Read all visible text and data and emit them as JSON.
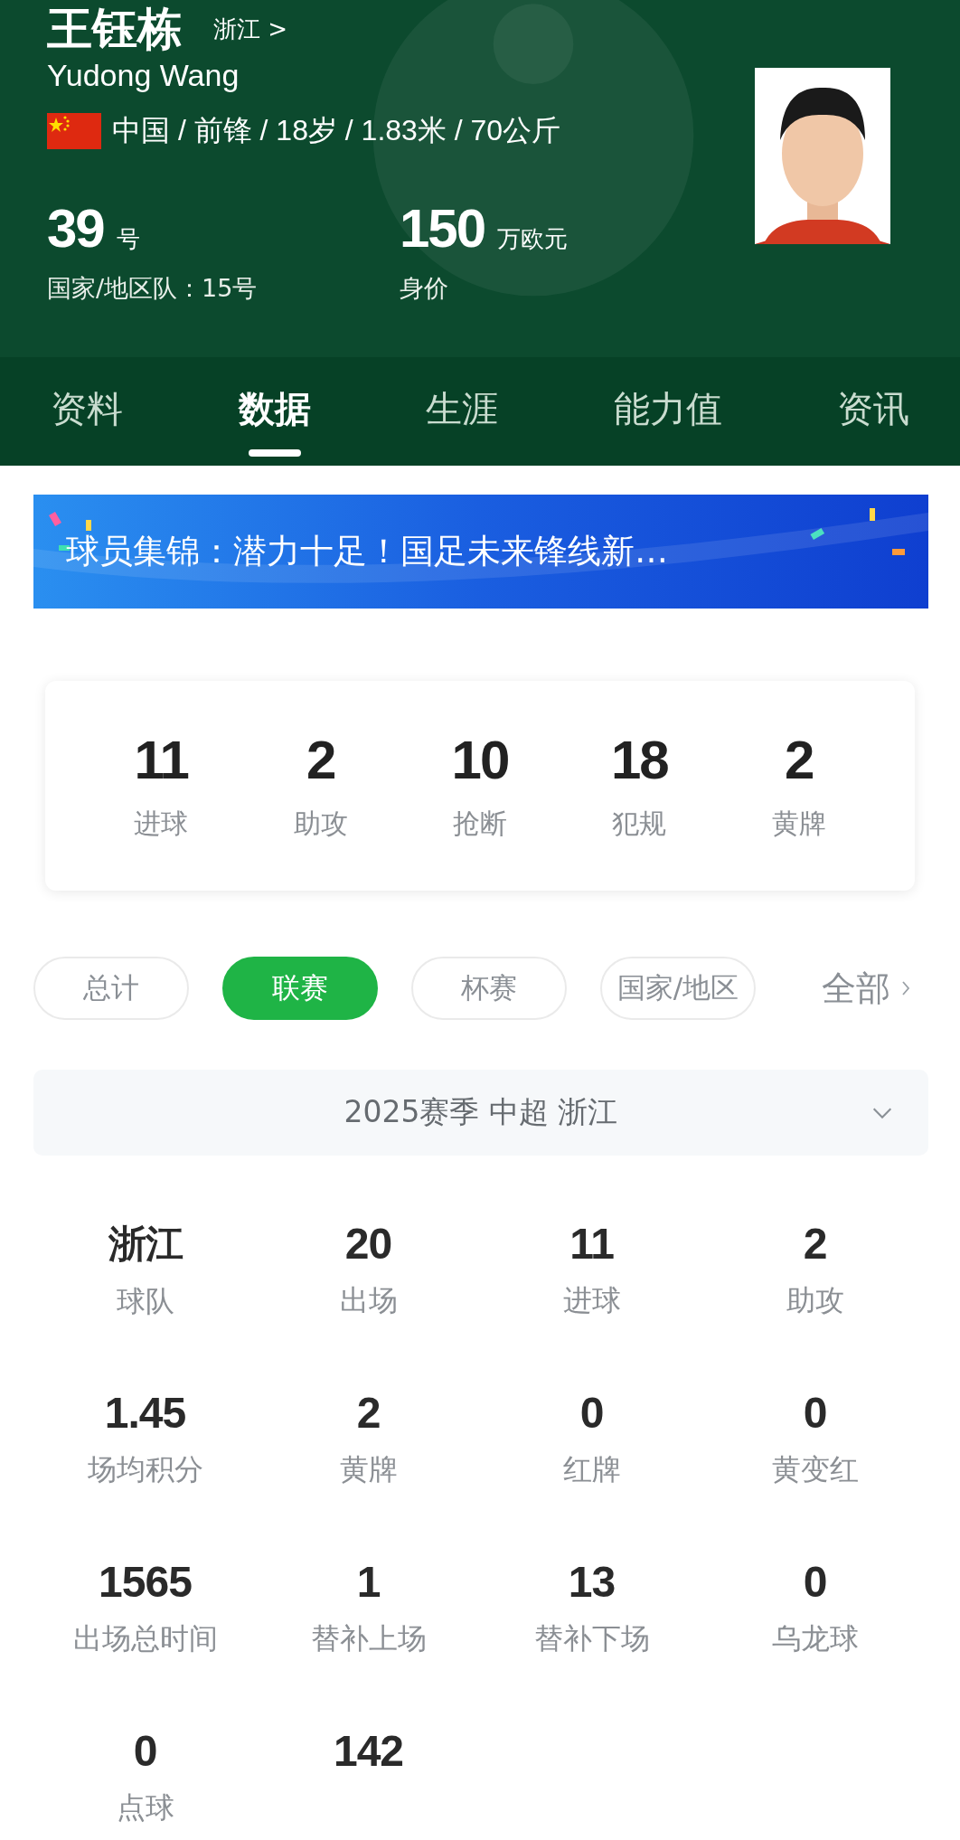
{
  "player": {
    "name": "王钰栋",
    "team_link": "浙江 >",
    "name_en": "Yudong Wang",
    "info": "中国 / 前锋 / 18岁 / 1.83米 / 70公斤",
    "number": "39",
    "number_unit": "号",
    "national_number": "国家/地区队：15号",
    "value": "150",
    "value_unit": "万欧元",
    "value_label": "身价"
  },
  "tabs": [
    {
      "label": "资料",
      "selected": false
    },
    {
      "label": "数据",
      "selected": true
    },
    {
      "label": "生涯",
      "selected": false
    },
    {
      "label": "能力值",
      "selected": false
    },
    {
      "label": "资讯",
      "selected": false
    }
  ],
  "banner": {
    "text": "球员集锦：潜力十足！国足未来锋线新…"
  },
  "summary": [
    {
      "value": "11",
      "label": "进球"
    },
    {
      "value": "2",
      "label": "助攻"
    },
    {
      "value": "10",
      "label": "抢断"
    },
    {
      "value": "18",
      "label": "犯规"
    },
    {
      "value": "2",
      "label": "黄牌"
    }
  ],
  "filters": [
    {
      "label": "总计",
      "selected": false
    },
    {
      "label": "联赛",
      "selected": true
    },
    {
      "label": "杯赛",
      "selected": false
    },
    {
      "label": "国家/地区",
      "selected": false
    }
  ],
  "filter_all": "全部",
  "season": "2025赛季 中超 浙江",
  "stats": [
    {
      "value": "浙江",
      "label": "球队"
    },
    {
      "value": "20",
      "label": "出场"
    },
    {
      "value": "11",
      "label": "进球"
    },
    {
      "value": "2",
      "label": "助攻"
    },
    {
      "value": "1.45",
      "label": "场均积分"
    },
    {
      "value": "2",
      "label": "黄牌"
    },
    {
      "value": "0",
      "label": "红牌"
    },
    {
      "value": "0",
      "label": "黄变红"
    },
    {
      "value": "1565",
      "label": "出场总时间"
    },
    {
      "value": "1",
      "label": "替补上场"
    },
    {
      "value": "13",
      "label": "替补下场"
    },
    {
      "value": "0",
      "label": "乌龙球"
    },
    {
      "value": "0",
      "label": "点球"
    },
    {
      "value": "142"
    }
  ]
}
